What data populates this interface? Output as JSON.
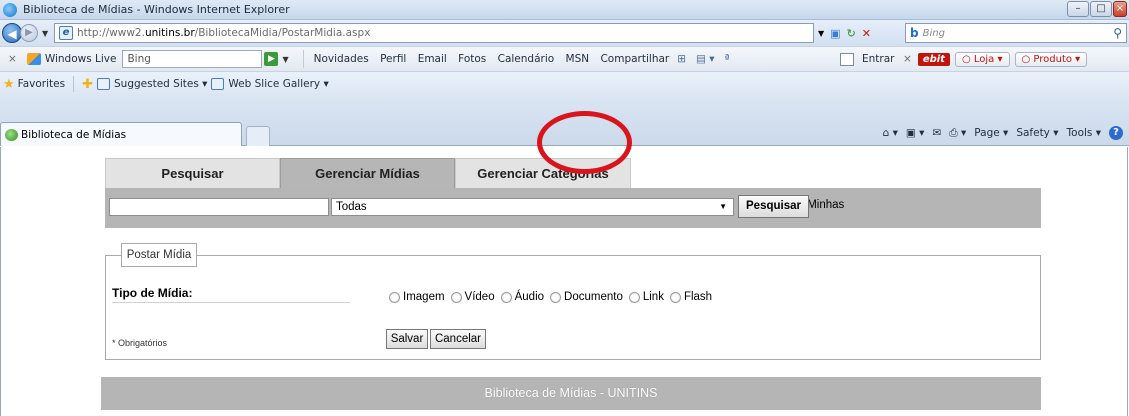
{
  "window": {
    "title": "Biblioteca de Mídias - Windows Internet Explorer"
  },
  "address": {
    "url_prefix": "http://www2.",
    "url_domain": "unitins.br",
    "url_path": "/BibliotecaMidia/PostarMidia.aspx",
    "search_engine": "Bing",
    "search_placeholder": "Bing"
  },
  "live_toolbar": {
    "brand": "Windows Live",
    "search_value": "Bing",
    "links": [
      "Novidades",
      "Perfil",
      "Email",
      "Fotos",
      "Calendário",
      "MSN",
      "Compartilhar"
    ],
    "signin": "Entrar",
    "ebit": "ebit",
    "loja": "Loja",
    "produto": "Produto"
  },
  "favorites_bar": {
    "favorites": "Favorites",
    "suggested": "Suggested Sites ▾",
    "webslice": "Web Slice Gallery ▾"
  },
  "tab": {
    "label": "Biblioteca de Mídias"
  },
  "command_bar": {
    "page": "Page ▾",
    "safety": "Safety ▾",
    "tools": "Tools ▾"
  },
  "site": {
    "tabs": [
      "Pesquisar",
      "Gerenciar Mídias",
      "Gerenciar Categorias"
    ],
    "active_tab": "Gerenciar Mídias",
    "search": {
      "input_value": "",
      "category_selected": "Todas",
      "only_mine_label": "Somente Minhas",
      "button": "Pesquisar"
    },
    "form": {
      "legend": "Postar Mídia",
      "tipo_label": "Tipo de Mídia:",
      "radio_options": [
        "Imagem",
        "Vídeo",
        "Áudio",
        "Documento",
        "Link",
        "Flash"
      ],
      "highlighted_option": "Documento",
      "required_note": "* Obrigatórios",
      "save": "Salvar",
      "cancel": "Cancelar"
    },
    "footer": "Biblioteca de Mídias - UNITINS"
  },
  "colors": {
    "highlight_circle": "#d9141b",
    "site_bar": "#b5b5b5",
    "active_tab": "#b6b6b6"
  }
}
